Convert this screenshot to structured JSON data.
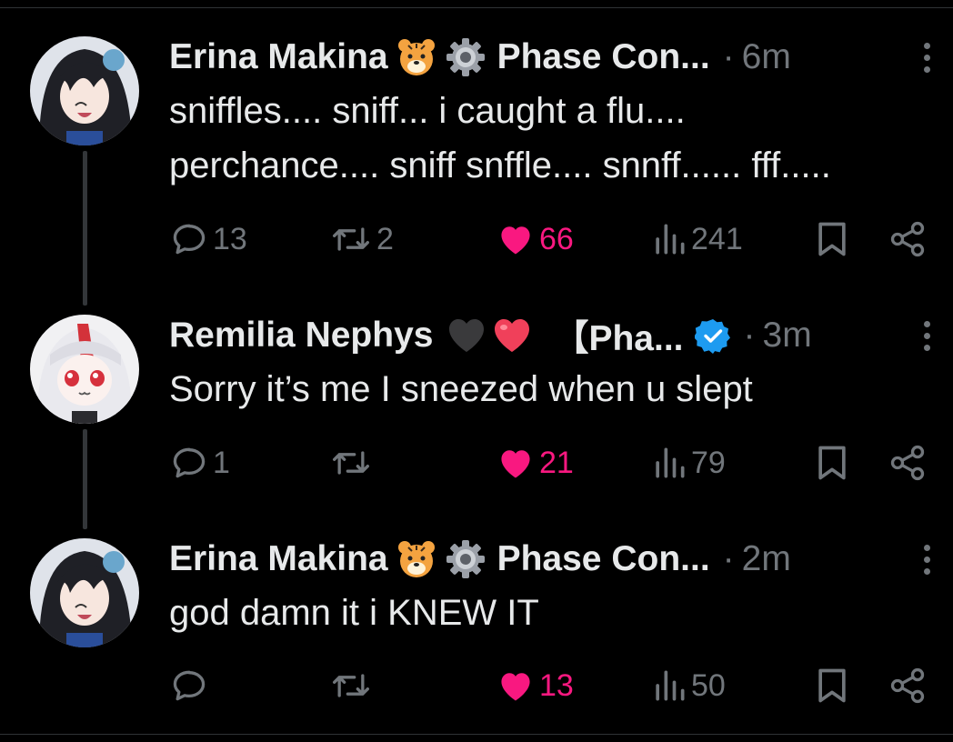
{
  "tweets": [
    {
      "author": "Erina Makina",
      "org": "Phase Con...",
      "time": "6m",
      "text": "sniffles.... sniff... i caught a flu....\nperchance.... sniff snffle.... snnff...... fff.....",
      "replies": "13",
      "retweets": "2",
      "likes": "66",
      "views": "241",
      "emojis": [
        "tiger-face-icon",
        "gear-icon"
      ],
      "verified": false
    },
    {
      "author": "Remilia Nephys",
      "org": "【Pha...",
      "time": "3m",
      "text": "Sorry it’s me I sneezed when u slept",
      "replies": "1",
      "retweets": "",
      "likes": "21",
      "views": "79",
      "emojis": [
        "black-heart-icon",
        "red-heart-icon"
      ],
      "verified": true
    },
    {
      "author": "Erina Makina",
      "org": "Phase Con...",
      "time": "2m",
      "text": "god damn it i KNEW IT",
      "replies": "",
      "retweets": "",
      "likes": "13",
      "views": "50",
      "emojis": [
        "tiger-face-icon",
        "gear-icon"
      ],
      "verified": false
    }
  ],
  "separator": "·",
  "colors": {
    "background": "#000000",
    "text": "#e7e9ea",
    "muted": "#71767b",
    "like": "#f91880",
    "verified": "#1d9bf0"
  }
}
